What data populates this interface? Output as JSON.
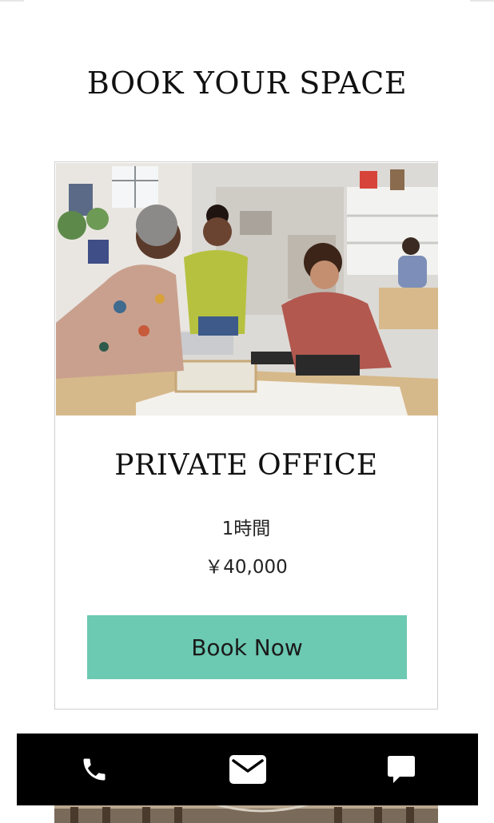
{
  "section": {
    "title": "BOOK YOUR SPACE"
  },
  "service_card": {
    "title": "PRIVATE OFFICE",
    "duration": "1時間",
    "price": "￥40,000",
    "book_button_label": "Book Now",
    "image_icon": "office-team-photo"
  },
  "bottom_bar": {
    "items": [
      {
        "icon": "phone-icon"
      },
      {
        "icon": "mail-icon"
      },
      {
        "icon": "chat-icon"
      }
    ]
  },
  "colors": {
    "accent": "#6cc9b2",
    "bar": "#000000",
    "text": "#111111"
  }
}
